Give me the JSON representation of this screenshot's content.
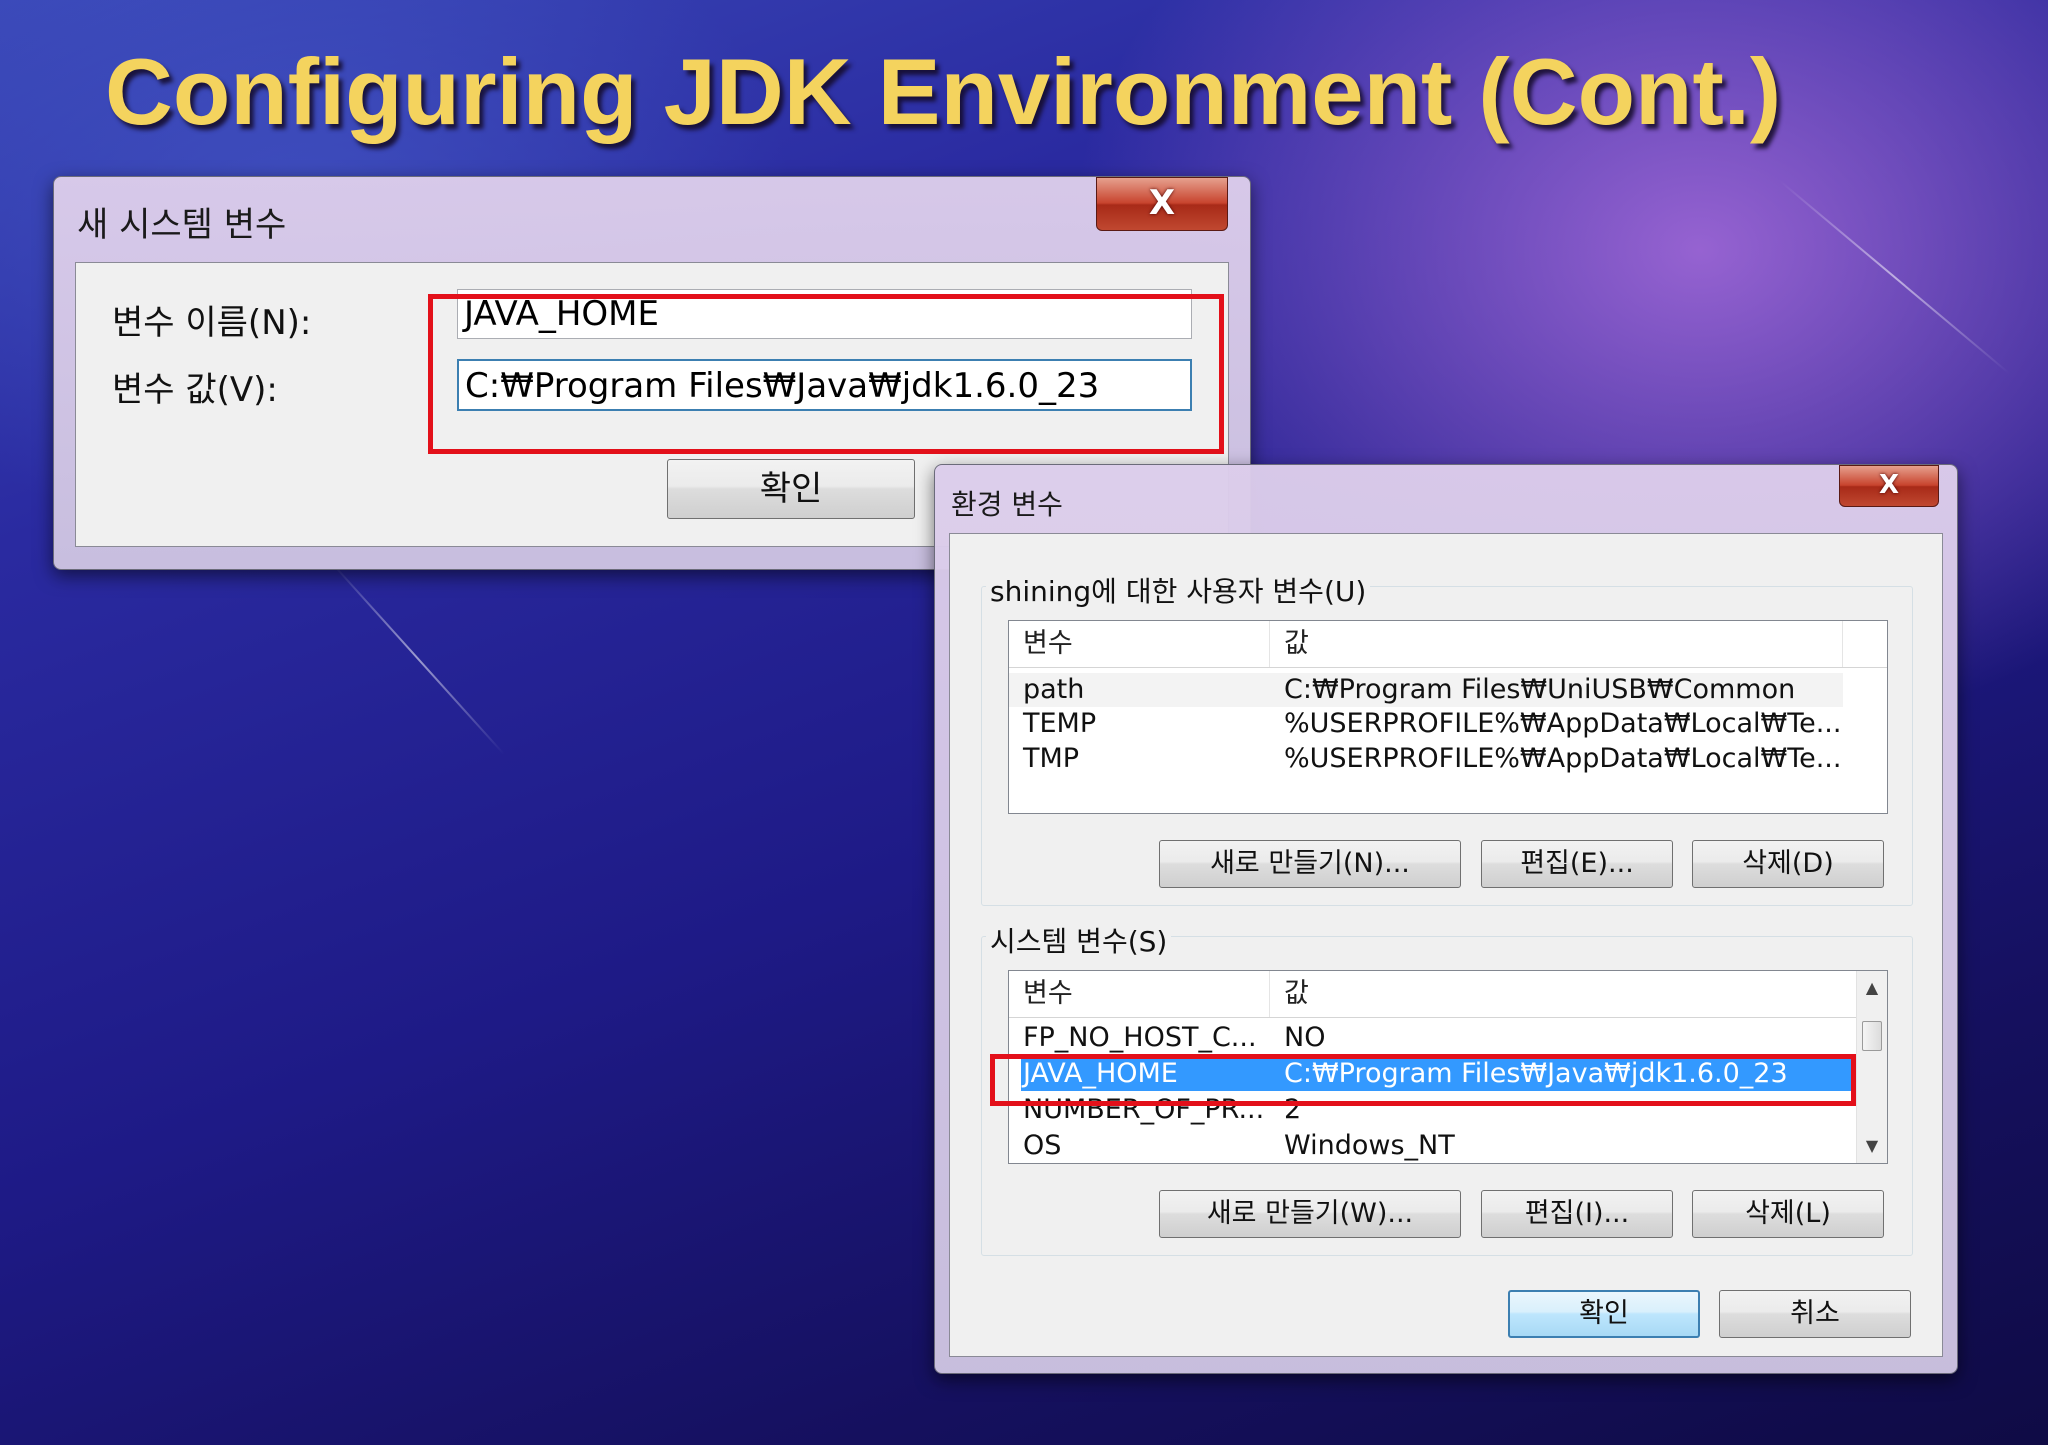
{
  "slide": {
    "title": "Configuring JDK Environment (Cont.)"
  },
  "new_var_dialog": {
    "title": "새 시스템 변수",
    "close_label": "X",
    "name_label": "변수 이름(N):",
    "value_label": "변수 값(V):",
    "name_value": "JAVA_HOME",
    "value_value": "C:₩Program Files₩Java₩jdk1.6.0_23",
    "ok_label": "확인"
  },
  "env_dialog": {
    "title": "환경 변수",
    "close_label": "X",
    "user_group": {
      "legend": "shining에 대한 사용자 변수(U)",
      "col_variable": "변수",
      "col_value": "값",
      "rows": [
        {
          "name": "path",
          "value": "C:₩Program Files₩UniUSB₩Common"
        },
        {
          "name": "TEMP",
          "value": "%USERPROFILE%₩AppData₩Local₩Te..."
        },
        {
          "name": "TMP",
          "value": "%USERPROFILE%₩AppData₩Local₩Te..."
        }
      ],
      "new_label": "새로 만들기(N)...",
      "edit_label": "편집(E)...",
      "delete_label": "삭제(D)"
    },
    "system_group": {
      "legend": "시스템 변수(S)",
      "col_variable": "변수",
      "col_value": "값",
      "rows": [
        {
          "name": "FP_NO_HOST_C...",
          "value": "NO"
        },
        {
          "name": "JAVA_HOME",
          "value": "C:₩Program Files₩Java₩jdk1.6.0_23",
          "selected": true
        },
        {
          "name": "NUMBER_OF_PR...",
          "value": "2"
        },
        {
          "name": "OS",
          "value": "Windows_NT"
        }
      ],
      "new_label": "새로 만들기(W)...",
      "edit_label": "편집(I)...",
      "delete_label": "삭제(L)"
    },
    "ok_label": "확인",
    "cancel_label": "취소"
  },
  "colors": {
    "title_yellow": "#f4d35e",
    "highlight_red": "#e3101a",
    "selection_blue": "#3399ff"
  }
}
